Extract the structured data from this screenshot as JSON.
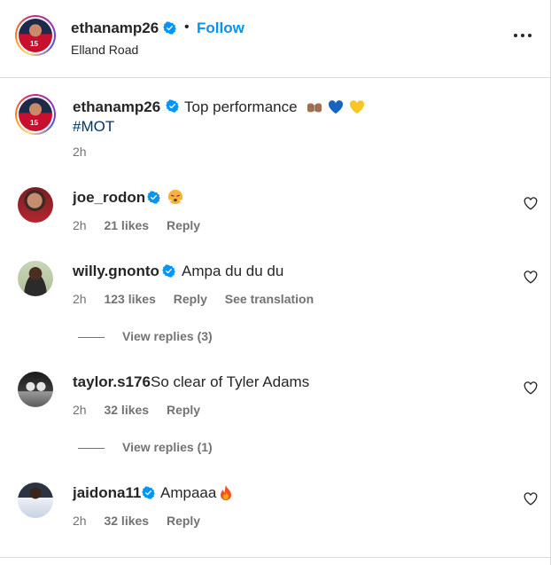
{
  "header": {
    "username": "ethanamp26",
    "separator": "•",
    "follow_label": "Follow",
    "location": "Elland Road",
    "jersey_number": "15"
  },
  "caption": {
    "username": "ethanamp26",
    "text": "Top performance",
    "emojis": [
      "fist-bump-emoji",
      "blue-heart-emoji",
      "yellow-heart-emoji"
    ],
    "hashtag": "#MOT",
    "time": "2h"
  },
  "comments": [
    {
      "username": "joe_rodon",
      "verified": true,
      "text": "",
      "emoji": "steaming-face-emoji",
      "time": "2h",
      "likes": "21 likes",
      "reply": "Reply",
      "translation": ""
    },
    {
      "username": "willy.gnonto",
      "verified": true,
      "text": "Ampa du du du",
      "emoji": "",
      "time": "2h",
      "likes": "123 likes",
      "reply": "Reply",
      "translation": "See translation",
      "view_replies": "View replies (3)"
    },
    {
      "username": "taylor.s176",
      "verified": false,
      "text": "So clear of Tyler Adams",
      "emoji": "",
      "time": "2h",
      "likes": "32 likes",
      "reply": "Reply",
      "translation": "",
      "view_replies": "View replies (1)"
    },
    {
      "username": "jaidona11",
      "verified": true,
      "text": "Ampaaa",
      "emoji": "fire-emoji",
      "time": "2h",
      "likes": "32 likes",
      "reply": "Reply",
      "translation": ""
    }
  ],
  "colors": {
    "link_blue": "#0095f6",
    "hashtag_blue": "#00376b",
    "verified_blue": "#0095f6",
    "muted_text": "#737373",
    "divider": "#dbdbdb"
  }
}
